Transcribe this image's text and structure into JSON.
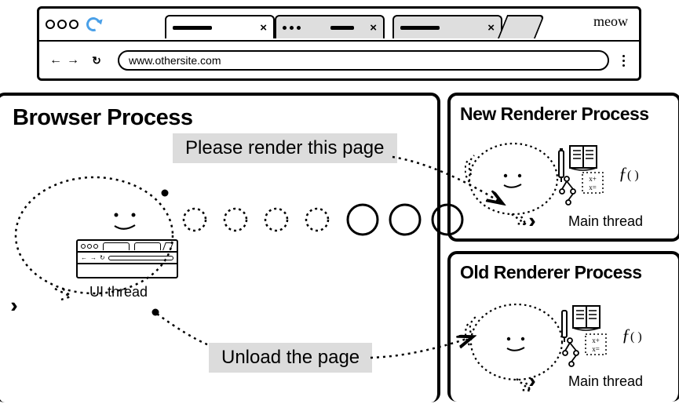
{
  "browser_chrome": {
    "titlebar_text": "meow",
    "url": "www.othersite.com"
  },
  "panels": {
    "browser": {
      "title": "Browser Process",
      "thread": "UI thread"
    },
    "new_renderer": {
      "title": "New Renderer Process",
      "thread": "Main thread"
    },
    "old_renderer": {
      "title": "Old Renderer Process",
      "thread": "Main thread"
    }
  },
  "messages": {
    "render": "Please render this page",
    "unload": "Unload the page"
  },
  "icons": {
    "fx": "f()",
    "math": "x+\nx="
  }
}
